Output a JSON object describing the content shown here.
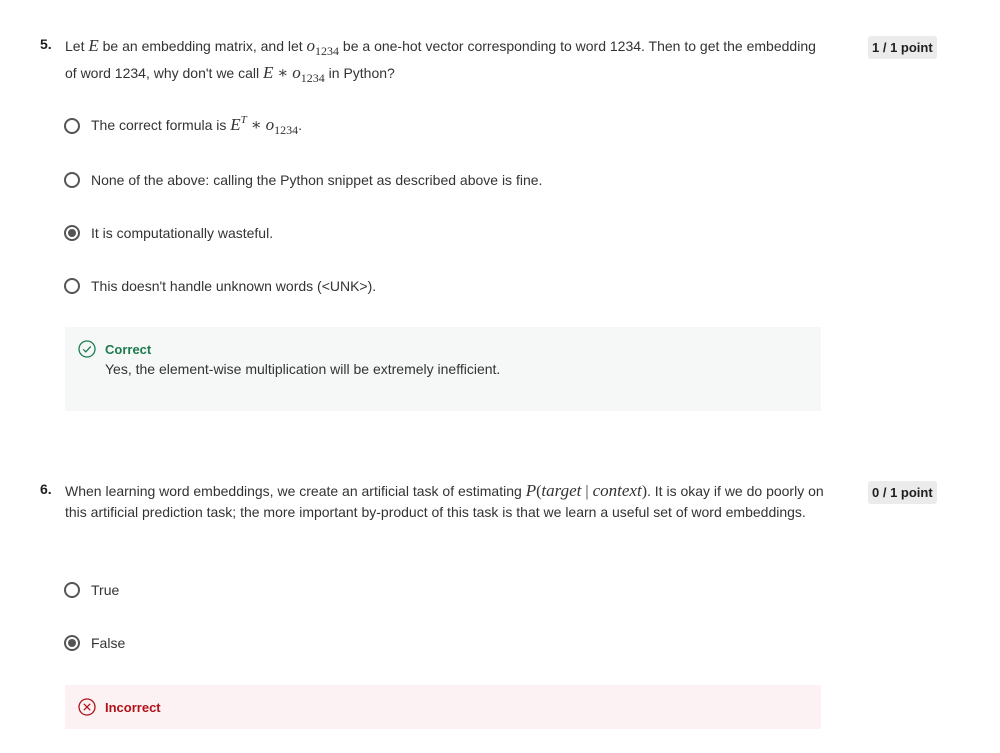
{
  "q5": {
    "number": "5.",
    "points": "1 / 1 point",
    "text": {
      "p1": "Let ",
      "E": "E",
      "p2": " be an embedding matrix, and let ",
      "o": "o",
      "sub": "1234",
      "p3": " be a one-hot vector corresponding to word 1234. Then to get the embedding of word 1234, why don't we call ",
      "op": " ∗ ",
      "p4": " in Python?"
    },
    "options": [
      {
        "text": "The correct formula is ",
        "math_E": "E",
        "math_T": "T",
        "math_op": " ∗ ",
        "math_o": "o",
        "math_sub": "1234",
        "tail": ".",
        "selected": false
      },
      {
        "label": "None of the above: calling the Python snippet as described above is fine.",
        "selected": false
      },
      {
        "label": "It is computationally wasteful.",
        "selected": true
      },
      {
        "label": "This doesn't handle unknown words (<UNK>).",
        "selected": false
      }
    ],
    "feedback": {
      "status": "Correct",
      "message": "Yes, the element-wise multiplication will be extremely inefficient.",
      "color": "#1e7a4f",
      "icon": "check-circle-icon"
    }
  },
  "q6": {
    "number": "6.",
    "points": "0 / 1 point",
    "text": {
      "p1": "When learning word embeddings, we create an artificial task of estimating ",
      "P": "P",
      "lparen": "(",
      "target": "target",
      "bar": " | ",
      "context": "context",
      "rparen": ")",
      "p2": ". It is okay if we do poorly on this artificial prediction task; the more important by-product of this task is that we learn a useful set of word embeddings."
    },
    "options": [
      {
        "label": "True",
        "selected": false
      },
      {
        "label": "False",
        "selected": true
      }
    ],
    "feedback": {
      "status": "Incorrect",
      "color": "#b0111a",
      "icon": "x-circle-icon"
    }
  }
}
